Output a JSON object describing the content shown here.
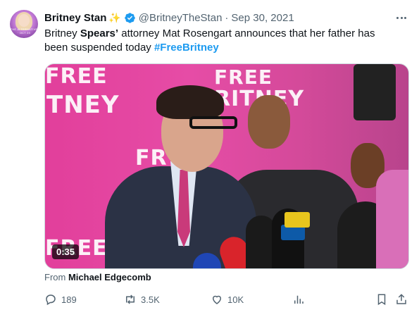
{
  "author": {
    "name": "Britney Stan",
    "emoji": "✨",
    "handle": "@BritneyTheStan",
    "separator": "·",
    "date": "Sep 30, 2021",
    "avatar_caption": "THE ALTERNATIVE · OCT 23"
  },
  "tweet": {
    "text_before": "Britney ",
    "text_bold": "Spears’",
    "text_middle": " attorney Mat Rosengart announces that her father has been suspended today ",
    "hashtag": "#FreeBritney"
  },
  "media": {
    "duration": "0:35",
    "bg_words": [
      "FREE",
      "TNEY",
      "FREE",
      "RITNEY",
      "FR",
      "FREE"
    ]
  },
  "source": {
    "label": "From ",
    "name": "Michael Edgecomb"
  },
  "actions": {
    "replies": "189",
    "retweets": "3.5K",
    "likes": "10K"
  },
  "colors": {
    "accent": "#1d9bf0",
    "secondary_text": "#536471",
    "backdrop_pink": "#e23f9b"
  },
  "icons": [
    "verified-badge-icon",
    "more-options-icon",
    "reply-icon",
    "retweet-icon",
    "like-icon",
    "views-icon",
    "bookmark-icon",
    "share-icon"
  ]
}
